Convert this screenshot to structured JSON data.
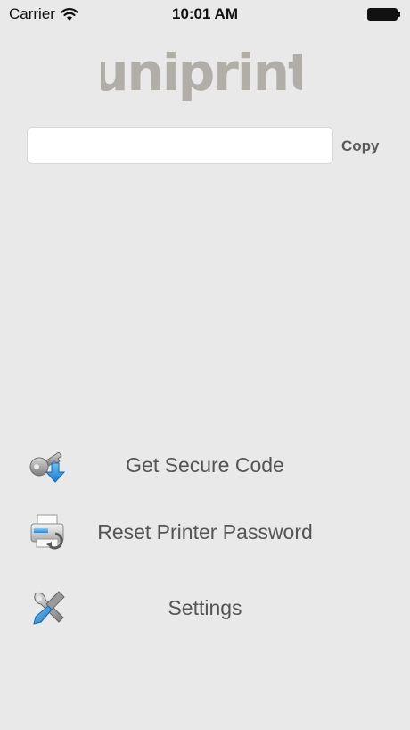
{
  "status_bar": {
    "carrier": "Carrier",
    "time": "10:01 AM",
    "wifi_icon": "wifi-icon",
    "battery_icon": "battery-icon"
  },
  "app": {
    "logo_text": "uniprint",
    "logo_color": "#b1aea8",
    "background_color": "#e9e9e9"
  },
  "code_field": {
    "value": "",
    "placeholder": ""
  },
  "copy_button": {
    "label": "Copy"
  },
  "menu": {
    "items": [
      {
        "label": "Get Secure Code",
        "icon": "key-download-icon"
      },
      {
        "label": "Reset Printer Password",
        "icon": "printer-reset-icon"
      },
      {
        "label": "Settings",
        "icon": "tools-icon"
      }
    ]
  }
}
